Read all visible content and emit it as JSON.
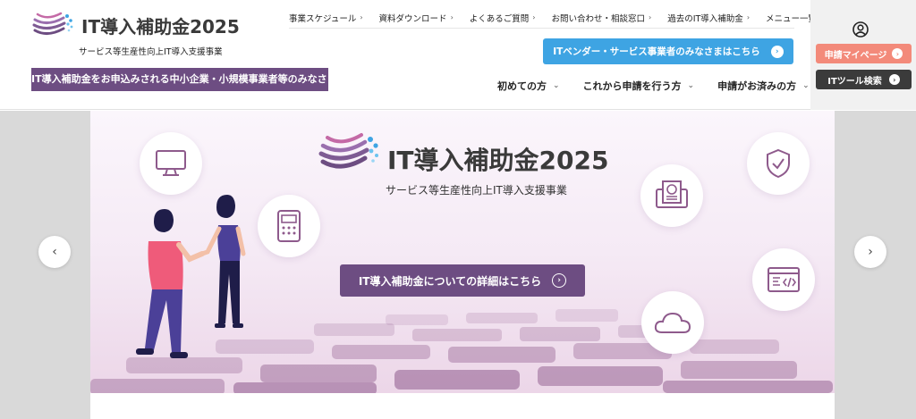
{
  "header": {
    "logo_text": "IT導入補助金2025",
    "logo_sub": "サービス等生産性向上IT導入支援事業",
    "smb_banner": "IT導入補助金をお申込みされる中小企業・小規模事業者等のみなさま",
    "top_nav": [
      {
        "label": "事業スケジュール",
        "chevron": "›"
      },
      {
        "label": "資料ダウンロード",
        "chevron": "›"
      },
      {
        "label": "よくあるご質問",
        "chevron": "›"
      },
      {
        "label": "お問い合わせ・相談窓口",
        "chevron": "›"
      },
      {
        "label": "過去のIT導入補助金",
        "chevron": "›"
      }
    ],
    "menu_label": "メニュー一覧",
    "vendor_button": "ITベンダー・サービス事業者のみなさまはこちら",
    "main_nav": [
      {
        "label": "初めての方",
        "chevron": "⌄"
      },
      {
        "label": "これから申請を行う方",
        "chevron": "⌄"
      },
      {
        "label": "申請がお済みの方",
        "chevron": "⌄"
      }
    ],
    "mypage_button": "申請マイページ",
    "tool_search_button": "ITツール検索",
    "arrow_glyph": "›"
  },
  "hero": {
    "title": "IT導入補助金2025",
    "subtitle": "サービス等生産性向上IT導入支援事業",
    "detail_button": "IT導入補助金についての詳細はこちら",
    "icons": [
      "monitor-icon",
      "payment-terminal-icon",
      "shield-check-icon",
      "yen-invoice-icon",
      "code-window-icon",
      "cloud-icon"
    ],
    "prev_arrow": "‹",
    "next_arrow": "›"
  },
  "colors": {
    "brand_purple": "#6d4d82",
    "vendor_blue": "#3ea4e3",
    "mypage_coral": "#f38a7a",
    "dark_button": "#3b3b3b"
  }
}
